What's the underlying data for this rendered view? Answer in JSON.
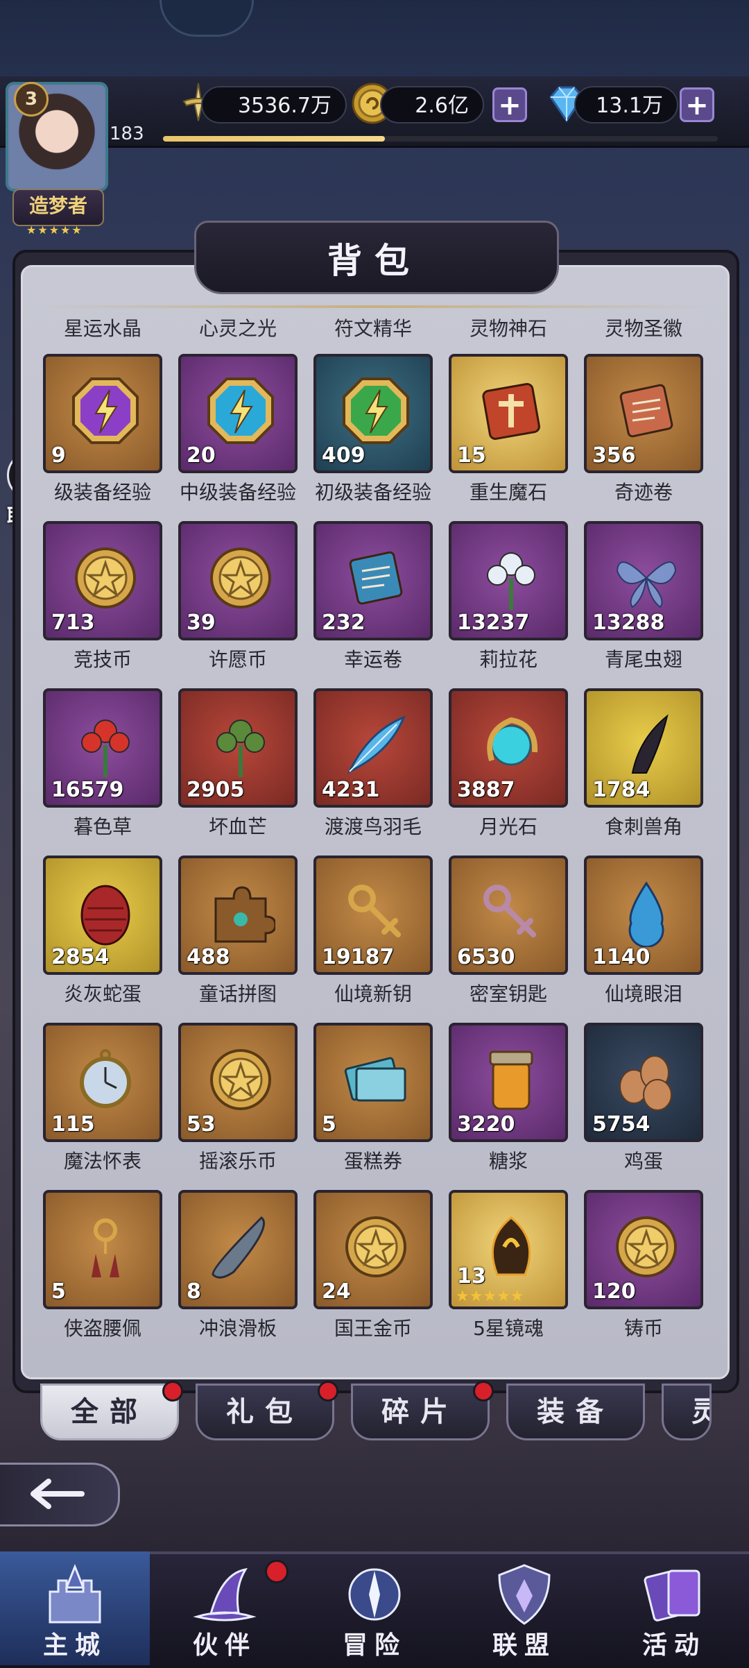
{
  "player": {
    "level": "3",
    "exp_level": "183",
    "title": "造梦者",
    "stars": "★★★★★",
    "exp_progress": 0.4
  },
  "resources": {
    "power": "3536.7万",
    "gold": "2.6亿",
    "diamond": "13.1万",
    "plus": "+"
  },
  "chat": {
    "label": "聊 天"
  },
  "panel": {
    "title": "背包"
  },
  "categories": [
    "星运水晶",
    "心灵之光",
    "符文精华",
    "灵物神石",
    "灵物圣徽"
  ],
  "items": [
    {
      "name": "级装备经验",
      "count": "9",
      "bg": "brown",
      "icon": "purple-bolt-octagon-icon",
      "color": "#8b3fc6"
    },
    {
      "name": "中级装备经验",
      "count": "20",
      "bg": "purple",
      "icon": "blue-bolt-octagon-icon",
      "color": "#2aa8d8"
    },
    {
      "name": "初级装备经验",
      "count": "409",
      "bg": "teal",
      "icon": "green-bolt-octagon-icon",
      "color": "#3aa84a"
    },
    {
      "name": "重生魔石",
      "count": "15",
      "bg": "gold",
      "icon": "rebirth-stone-icon",
      "color": "#c0452a"
    },
    {
      "name": "奇迹卷",
      "count": "356",
      "bg": "brown",
      "icon": "miracle-scroll-icon",
      "color": "#c86a4a"
    },
    {
      "name": "竞技币",
      "count": "713",
      "bg": "purple",
      "icon": "arena-coin-icon",
      "color": "#d6a64a"
    },
    {
      "name": "许愿币",
      "count": "39",
      "bg": "purple",
      "icon": "wish-coin-icon",
      "color": "#d6a64a"
    },
    {
      "name": "幸运卷",
      "count": "232",
      "bg": "purple",
      "icon": "luck-scroll-icon",
      "color": "#3a8ab8"
    },
    {
      "name": "莉拉花",
      "count": "13237",
      "bg": "purple",
      "icon": "lila-flower-icon",
      "color": "#e8eef6"
    },
    {
      "name": "青尾虫翅",
      "count": "13288",
      "bg": "purple",
      "icon": "insect-wing-icon",
      "color": "#7aa8d8"
    },
    {
      "name": "暮色草",
      "count": "16579",
      "bg": "purple",
      "icon": "twilight-herb-icon",
      "color": "#d6342a"
    },
    {
      "name": "坏血芒",
      "count": "2905",
      "bg": "red",
      "icon": "blood-thorn-plant-icon",
      "color": "#5a8a3a"
    },
    {
      "name": "渡渡鸟羽毛",
      "count": "4231",
      "bg": "red",
      "icon": "feather-icon",
      "color": "#5ab6e8"
    },
    {
      "name": "月光石",
      "count": "3887",
      "bg": "red",
      "icon": "moonstone-icon",
      "color": "#3ad0e0"
    },
    {
      "name": "食刺兽角",
      "count": "1784",
      "bg": "yellow",
      "icon": "beast-horn-icon",
      "color": "#2a2430"
    },
    {
      "name": "炎灰蛇蛋",
      "count": "2854",
      "bg": "yellow",
      "icon": "snake-egg-icon",
      "color": "#a8282a"
    },
    {
      "name": "童话拼图",
      "count": "488",
      "bg": "brown",
      "icon": "puzzle-piece-icon",
      "color": "#8a5a2a"
    },
    {
      "name": "仙境新钥",
      "count": "19187",
      "bg": "brown",
      "icon": "golden-key-icon",
      "color": "#d6a64a"
    },
    {
      "name": "密室钥匙",
      "count": "6530",
      "bg": "brown",
      "icon": "winged-key-icon",
      "color": "#b88aa8"
    },
    {
      "name": "仙境眼泪",
      "count": "1140",
      "bg": "brown",
      "icon": "teardrop-icon",
      "color": "#3a9ad8"
    },
    {
      "name": "魔法怀表",
      "count": "115",
      "bg": "brown",
      "icon": "pocket-watch-icon",
      "color": "#c8d8e8"
    },
    {
      "name": "摇滚乐币",
      "count": "53",
      "bg": "brown",
      "icon": "rock-coin-icon",
      "color": "#d6a64a"
    },
    {
      "name": "蛋糕券",
      "count": "5",
      "bg": "brown",
      "icon": "cake-ticket-icon",
      "color": "#5ab6c8"
    },
    {
      "name": "糖浆",
      "count": "3220",
      "bg": "purple",
      "icon": "syrup-jar-icon",
      "color": "#e89a2a"
    },
    {
      "name": "鸡蛋",
      "count": "5754",
      "bg": "dark",
      "icon": "eggs-icon",
      "color": "#c88a5a"
    },
    {
      "name": "侠盗腰佩",
      "count": "5",
      "bg": "brown",
      "icon": "thief-pendant-icon",
      "color": "#8a2a2a"
    },
    {
      "name": "冲浪滑板",
      "count": "8",
      "bg": "brown",
      "icon": "surfboard-icon",
      "color": "#6a7a8a"
    },
    {
      "name": "国王金币",
      "count": "24",
      "bg": "brown",
      "icon": "king-coin-icon",
      "color": "#d6a64a"
    },
    {
      "name": "5星镜魂",
      "count": "13",
      "bg": "gold",
      "icon": "mirror-soul-icon",
      "color": "#3a2414",
      "stars": "★★★★★"
    },
    {
      "name": "铸币",
      "count": "120",
      "bg": "purple",
      "icon": "mint-coin-icon",
      "color": "#d6a64a"
    }
  ],
  "tabs": [
    {
      "label": "全部",
      "active": true,
      "dot": true
    },
    {
      "label": "礼包",
      "active": false,
      "dot": true
    },
    {
      "label": "碎片",
      "active": false,
      "dot": true
    },
    {
      "label": "装备",
      "active": false,
      "dot": false
    },
    {
      "label": "灵",
      "active": false,
      "dot": false
    }
  ],
  "nav": [
    {
      "label": "主城",
      "icon": "castle-icon",
      "active": true,
      "dot": false
    },
    {
      "label": "伙伴",
      "icon": "witch-hat-icon",
      "active": false,
      "dot": true
    },
    {
      "label": "冒险",
      "icon": "compass-icon",
      "active": false,
      "dot": false
    },
    {
      "label": "联盟",
      "icon": "shield-crest-icon",
      "active": false,
      "dot": false
    },
    {
      "label": "活动",
      "icon": "cards-icon",
      "active": false,
      "dot": false
    }
  ]
}
